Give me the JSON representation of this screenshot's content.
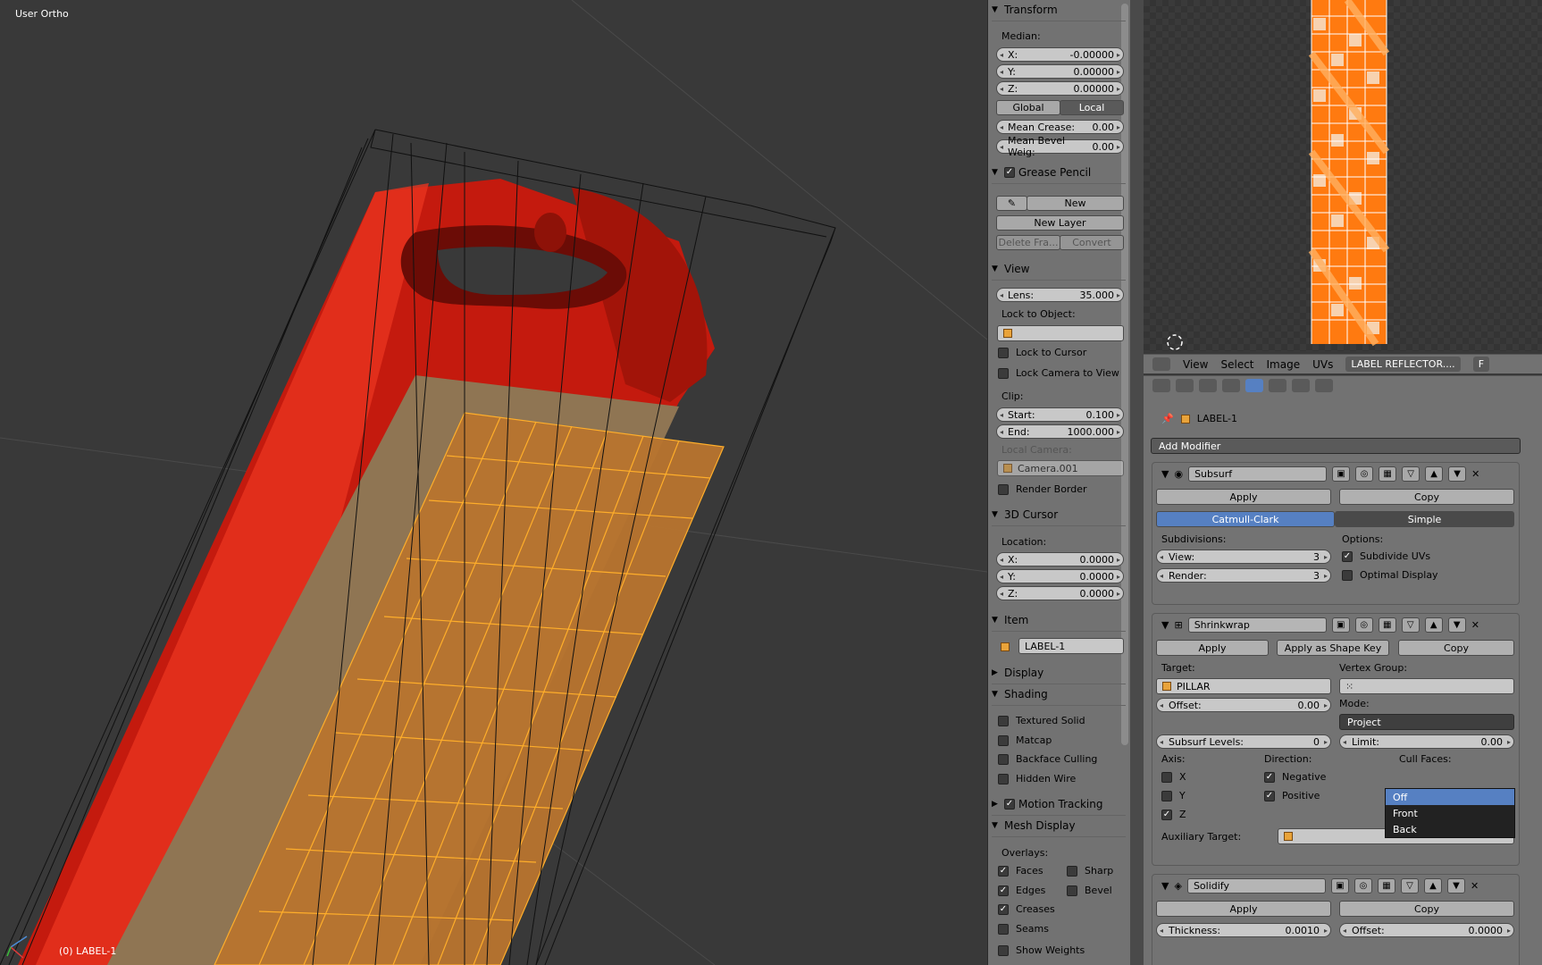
{
  "viewport": {
    "title": "User Ortho",
    "object_label": "(0) LABEL-1"
  },
  "npanel": {
    "transform": {
      "header": "Transform",
      "median_label": "Median:",
      "x_label": "X:",
      "x_value": "-0.00000",
      "y_label": "Y:",
      "y_value": "0.00000",
      "z_label": "Z:",
      "z_value": "0.00000",
      "global_label": "Global",
      "local_label": "Local",
      "mean_crease_label": "Mean Crease:",
      "mean_crease_value": "0.00",
      "mean_bevel_label": "Mean Bevel Weig:",
      "mean_bevel_value": "0.00"
    },
    "grease_pencil": {
      "header": "Grease Pencil",
      "new_label": "New",
      "new_layer_label": "New Layer",
      "delete_frame_label": "Delete Fra...",
      "convert_label": "Convert"
    },
    "view": {
      "header": "View",
      "lens_label": "Lens:",
      "lens_value": "35.000",
      "lock_to_object_label": "Lock to Object:",
      "lock_to_cursor_label": "Lock to Cursor",
      "lock_camera_label": "Lock Camera to View",
      "clip_label": "Clip:",
      "start_label": "Start:",
      "start_value": "0.100",
      "end_label": "End:",
      "end_value": "1000.000",
      "local_camera_label": "Local Camera:",
      "local_camera_value": "Camera.001",
      "render_border_label": "Render Border"
    },
    "cursor": {
      "header": "3D Cursor",
      "location_label": "Location:",
      "x_label": "X:",
      "x_value": "0.0000",
      "y_label": "Y:",
      "y_value": "0.0000",
      "z_label": "Z:",
      "z_value": "0.0000"
    },
    "item": {
      "header": "Item",
      "name": "LABEL-1"
    },
    "display": {
      "header": "Display"
    },
    "shading": {
      "header": "Shading",
      "textured_solid": "Textured Solid",
      "matcap": "Matcap",
      "backface_culling": "Backface Culling",
      "hidden_wire": "Hidden Wire"
    },
    "motion_tracking": {
      "header": "Motion Tracking"
    },
    "mesh_display": {
      "header": "Mesh Display",
      "overlays_label": "Overlays:",
      "faces": "Faces",
      "sharp": "Sharp",
      "edges": "Edges",
      "bevel": "Bevel",
      "creases": "Creases",
      "seams": "Seams",
      "show_weights": "Show Weights"
    }
  },
  "uv_header": {
    "menus": [
      "View",
      "Select",
      "Image",
      "UVs"
    ],
    "image_name": "LABEL REFLECTOR....",
    "f_label": "F"
  },
  "properties": {
    "object_name": "LABEL-1",
    "add_modifier": "Add Modifier",
    "subsurf": {
      "name": "Subsurf",
      "apply": "Apply",
      "copy": "Copy",
      "catmull": "Catmull-Clark",
      "simple": "Simple",
      "subdivisions_label": "Subdivisions:",
      "options_label": "Options:",
      "view_label": "View:",
      "view_value": "3",
      "render_label": "Render:",
      "render_value": "3",
      "subdivide_uvs": "Subdivide UVs",
      "optimal_display": "Optimal Display"
    },
    "shrinkwrap": {
      "name": "Shrinkwrap",
      "apply": "Apply",
      "apply_shape": "Apply as Shape Key",
      "copy": "Copy",
      "target_label": "Target:",
      "target_value": "PILLAR",
      "vertex_group_label": "Vertex Group:",
      "offset_label": "Offset:",
      "offset_value": "0.00",
      "mode_label": "Mode:",
      "mode_value": "Project",
      "subsurf_levels_label": "Subsurf Levels:",
      "subsurf_levels_value": "0",
      "limit_label": "Limit:",
      "limit_value": "0.00",
      "axis_label": "Axis:",
      "direction_label": "Direction:",
      "cull_faces_label": "Cull Faces:",
      "x": "X",
      "y": "Y",
      "z": "Z",
      "negative": "Negative",
      "positive": "Positive",
      "cull_options": [
        "Off",
        "Front",
        "Back"
      ],
      "auxiliary_label": "Auxiliary Target:"
    },
    "solidify": {
      "name": "Solidify",
      "apply": "Apply",
      "copy": "Copy",
      "thickness_label": "Thickness:",
      "thickness_value": "0.0010",
      "offset_label": "Offset:",
      "offset_value": "0.0000"
    }
  }
}
